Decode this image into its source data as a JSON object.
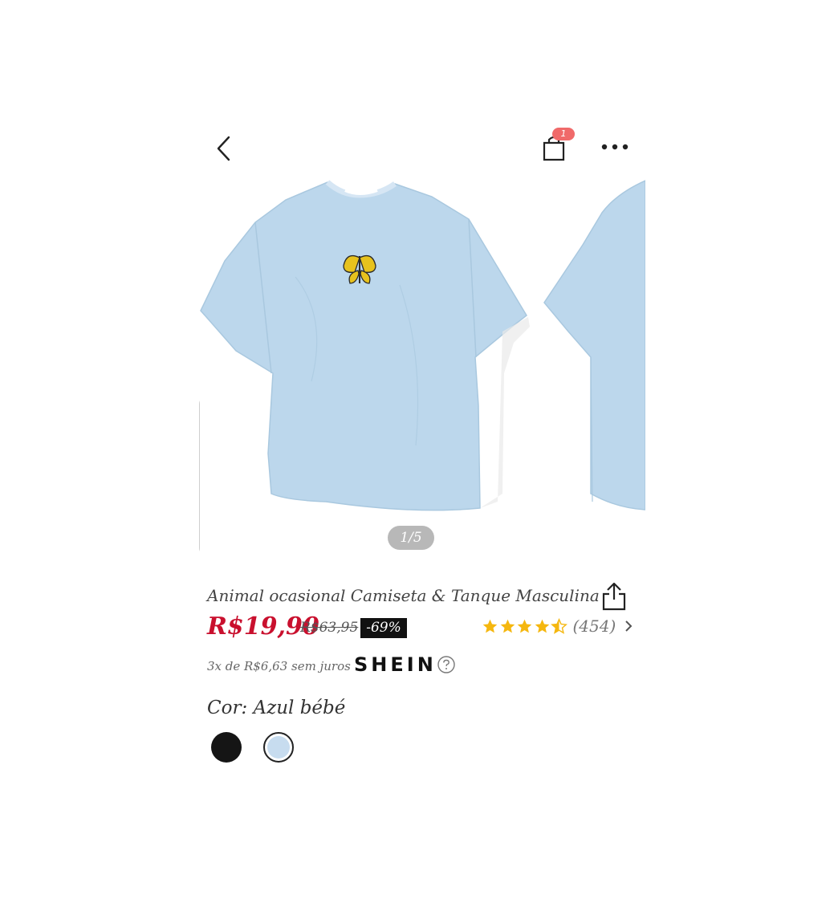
{
  "header": {
    "back_icon": "chevron-left-icon",
    "cart_icon": "shopping-bag-icon",
    "cart_badge": "1",
    "more_icon": "more-horizontal-icon"
  },
  "gallery": {
    "counter": "1/5",
    "main_color": "#bcd7ec",
    "accent_color": "#e7c21d"
  },
  "product": {
    "title": "Animal ocasional Camiseta & Tanque Masculina",
    "price": "R$19,90",
    "old_price": "R$63,95",
    "discount": "-69%",
    "rating_stars": 4.5,
    "rating_count": "(454)",
    "installments": "3x de R$6,63 sem juros",
    "brand": "SHEIN"
  },
  "color": {
    "label": "Cor: Azul bébé",
    "swatches": [
      "#151515",
      "#c7dcef"
    ]
  },
  "colors": {
    "price_red": "#c9102e",
    "star_yellow": "#f5b70f",
    "badge_red": "#f06a6a"
  }
}
